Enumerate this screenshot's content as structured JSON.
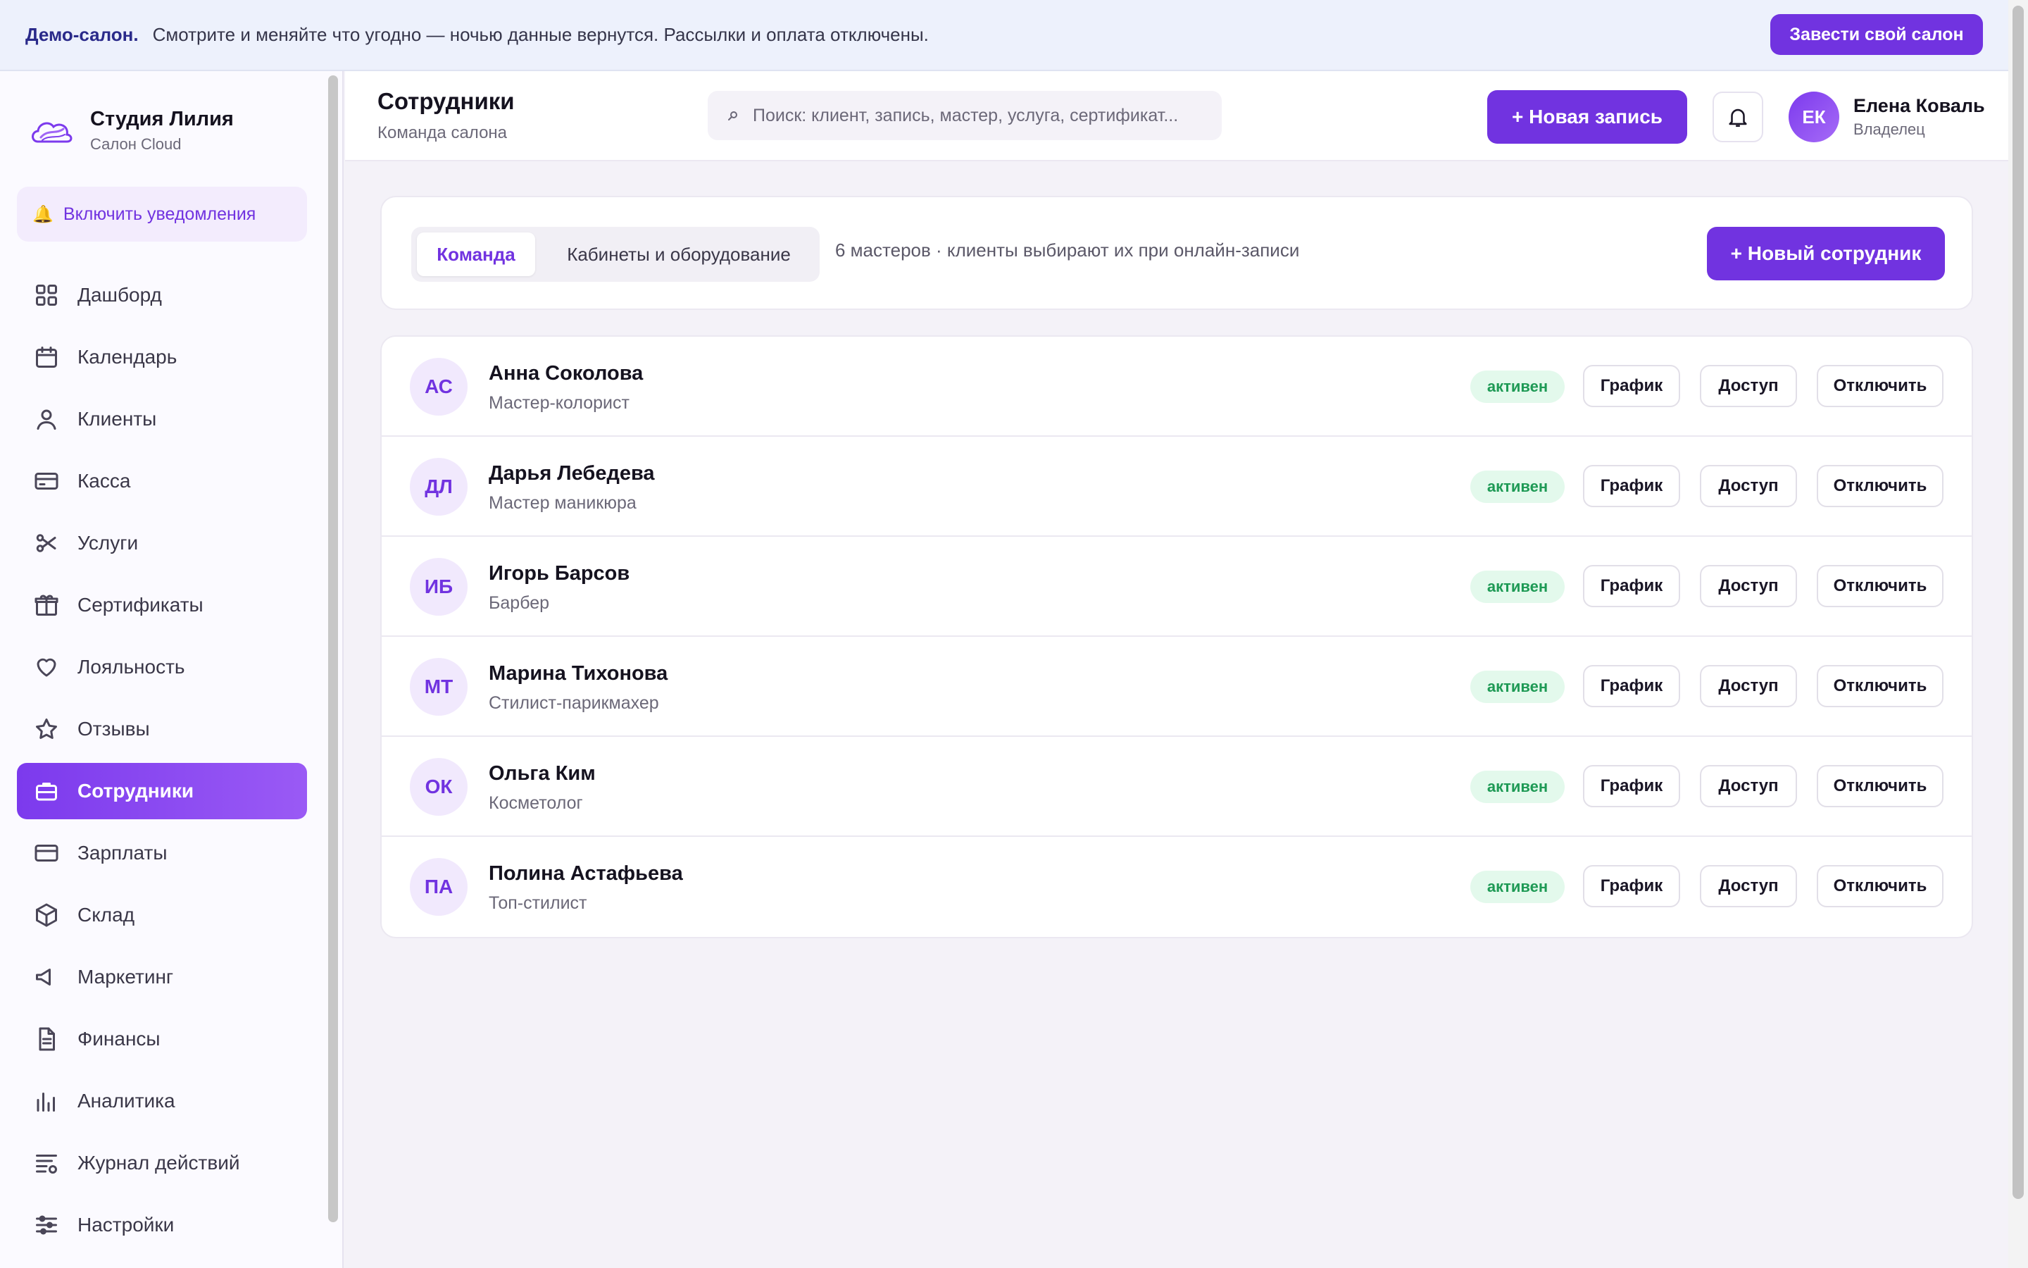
{
  "banner": {
    "strong": "Демо-салон.",
    "text": "Смотрите и меняйте что угодно — ночью данные вернутся. Рассылки и оплата отключены.",
    "button": "Завести свой салон"
  },
  "sidebar": {
    "brand_name": "Студия Лилия",
    "brand_sub": "Салон Cloud",
    "notify_icon": "🔔",
    "notify_label": "Включить уведомления",
    "items": [
      {
        "label": "Дашборд",
        "icon": "grid-icon"
      },
      {
        "label": "Календарь",
        "icon": "calendar-icon"
      },
      {
        "label": "Клиенты",
        "icon": "user-icon"
      },
      {
        "label": "Касса",
        "icon": "card-icon"
      },
      {
        "label": "Услуги",
        "icon": "scissors-icon"
      },
      {
        "label": "Сертификаты",
        "icon": "gift-icon"
      },
      {
        "label": "Лояльность",
        "icon": "heart-icon"
      },
      {
        "label": "Отзывы",
        "icon": "star-icon"
      },
      {
        "label": "Сотрудники",
        "icon": "briefcase-icon",
        "active": true
      },
      {
        "label": "Зарплаты",
        "icon": "wallet-icon"
      },
      {
        "label": "Склад",
        "icon": "box-icon"
      },
      {
        "label": "Маркетинг",
        "icon": "megaphone-icon"
      },
      {
        "label": "Финансы",
        "icon": "document-icon"
      },
      {
        "label": "Аналитика",
        "icon": "bar-chart-icon"
      },
      {
        "label": "Журнал действий",
        "icon": "log-icon"
      },
      {
        "label": "Настройки",
        "icon": "sliders-icon"
      }
    ]
  },
  "header": {
    "title": "Сотрудники",
    "subtitle": "Команда салона",
    "search_placeholder": "Поиск: клиент, запись, мастер, услуга, сертификат...",
    "new_record": "+ Новая запись",
    "user_initials": "ЕК",
    "user_name": "Елена Коваль",
    "user_role": "Владелец"
  },
  "toolbar": {
    "tab_team": "Команда",
    "tab_rooms": "Кабинеты и оборудование",
    "meta": "6 мастеров · клиенты выбирают их при онлайн-записи",
    "new_employee": "+ Новый сотрудник"
  },
  "employees": [
    {
      "initials": "АС",
      "name": "Анна Соколова",
      "role": "Мастер-колорист",
      "status": "активен"
    },
    {
      "initials": "ДЛ",
      "name": "Дарья Лебедева",
      "role": "Мастер маникюра",
      "status": "активен"
    },
    {
      "initials": "ИБ",
      "name": "Игорь Барсов",
      "role": "Барбер",
      "status": "активен"
    },
    {
      "initials": "МТ",
      "name": "Марина Тихонова",
      "role": "Стилист-парикмахер",
      "status": "активен"
    },
    {
      "initials": "ОК",
      "name": "Ольга Ким",
      "role": "Косметолог",
      "status": "активен"
    },
    {
      "initials": "ПА",
      "name": "Полина Астафьева",
      "role": "Топ-стилист",
      "status": "активен"
    }
  ],
  "row_actions": {
    "schedule": "График",
    "access": "Доступ",
    "disable": "Отключить"
  },
  "colors": {
    "accent": "#7133e0",
    "status_active_bg": "#e3f9ec",
    "status_active_text": "#1e9a55"
  }
}
